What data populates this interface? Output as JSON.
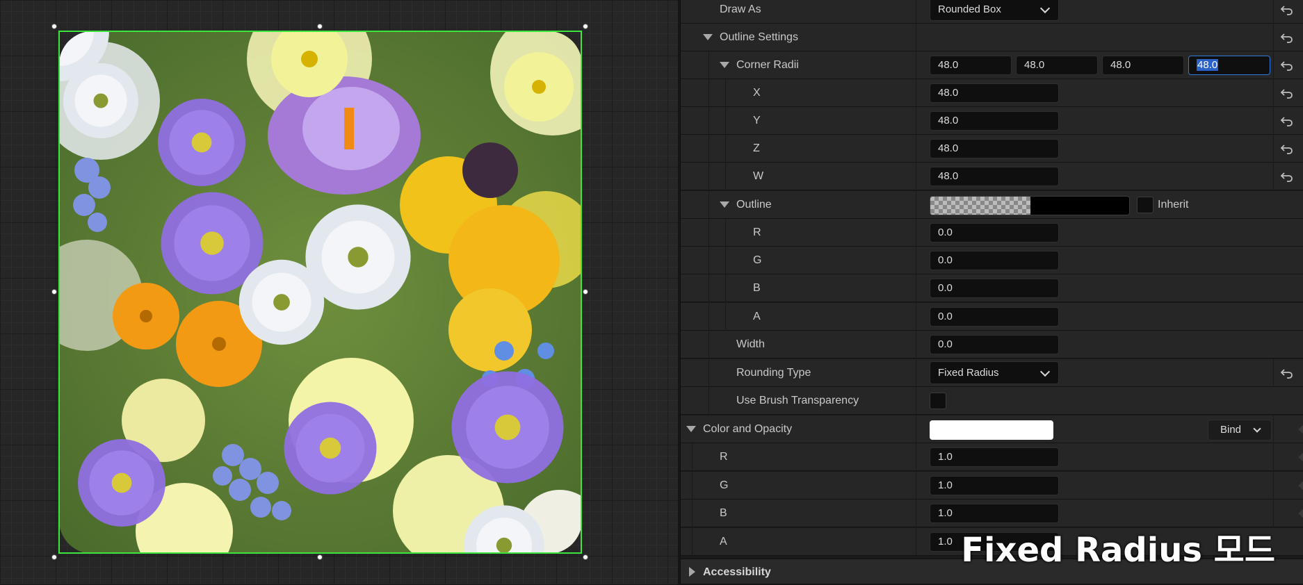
{
  "panel": {
    "draw_as": {
      "label": "Draw As",
      "value": "Rounded Box"
    },
    "outline_settings": {
      "label": "Outline Settings"
    },
    "corner_radii": {
      "label": "Corner Radii",
      "values": [
        "48.0",
        "48.0",
        "48.0",
        "48.0"
      ],
      "x_label": "X",
      "x": "48.0",
      "y_label": "Y",
      "y": "48.0",
      "z_label": "Z",
      "z": "48.0",
      "w_label": "W",
      "w": "48.0"
    },
    "outline": {
      "label": "Outline",
      "inherit_label": "Inherit",
      "r_label": "R",
      "r": "0.0",
      "g_label": "G",
      "g": "0.0",
      "b_label": "B",
      "b": "0.0",
      "a_label": "A",
      "a": "0.0"
    },
    "width": {
      "label": "Width",
      "value": "0.0"
    },
    "rounding_type": {
      "label": "Rounding Type",
      "value": "Fixed Radius"
    },
    "use_brush_transparency": {
      "label": "Use Brush Transparency"
    },
    "color_and_opacity": {
      "label": "Color and Opacity",
      "bind_label": "Bind",
      "r_label": "R",
      "r": "1.0",
      "g_label": "G",
      "g": "1.0",
      "b_label": "B",
      "b": "1.0",
      "a_label": "A",
      "a": "1.0"
    },
    "accessibility": {
      "label": "Accessibility"
    }
  },
  "caption": "Fixed Radius 모드",
  "colors": {
    "selection": "#3de63d",
    "focus": "#2f7bd9",
    "panel_row": "#262626",
    "field": "#0f0f0f"
  },
  "icons": [
    "reset-arrow-icon",
    "chevron-down-icon",
    "expand-triangle-icon",
    "collapse-triangle-icon"
  ]
}
